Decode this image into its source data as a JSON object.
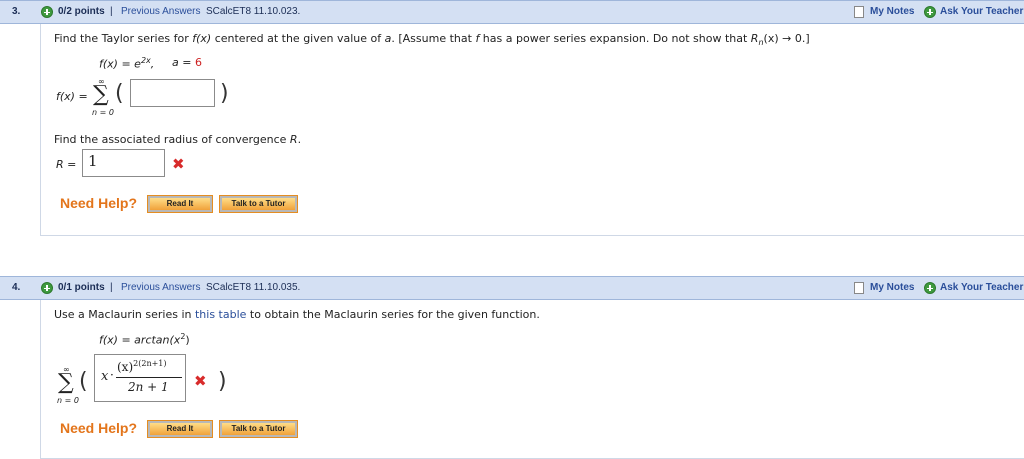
{
  "q3": {
    "number": "3.",
    "points": "0/2 points",
    "separator": "|",
    "previous_answers": "Previous Answers",
    "code": "SCalcET8 11.10.023.",
    "my_notes": "My Notes",
    "ask_teacher": "Ask Your Teacher",
    "prompt_a": "Find the Taylor series for ",
    "prompt_fx": "f(x)",
    "prompt_b": " centered at the given value of ",
    "prompt_avar": "a",
    "prompt_c": ". [Assume that ",
    "prompt_f": "f",
    "prompt_d": " has a power series expansion. Do not show that ",
    "prompt_rn": "R",
    "prompt_rn_sub": "n",
    "prompt_e": "(x) → 0.]",
    "func_lhs": "f(x) = e",
    "func_exp": "2x",
    "func_comma": ",",
    "a_label": "a = ",
    "a_value": "6",
    "series_lhs": "f(x) = ",
    "sum_top": "∞",
    "sum_bottom": "n = 0",
    "sigma": "∑",
    "paren_open": "(",
    "paren_close": ")",
    "series_answer": "",
    "radius_prompt_a": "Find the associated radius of convergence ",
    "radius_prompt_r": "R",
    "radius_prompt_b": ".",
    "radius_label": "R = ",
    "radius_value": "1",
    "radius_status": "✖",
    "need_help": "Need Help?",
    "read_it": "Read It",
    "talk_tutor": "Talk to a Tutor"
  },
  "q4": {
    "number": "4.",
    "points": "0/1 points",
    "separator": "|",
    "previous_answers": "Previous Answers",
    "code": "SCalcET8 11.10.035.",
    "my_notes": "My Notes",
    "ask_teacher": "Ask Your Teacher",
    "prompt_a": "Use a Maclaurin series in ",
    "prompt_link": "this table",
    "prompt_b": " to obtain the Maclaurin series for the given function.",
    "func_lhs": "f(x) = arctan(x",
    "func_exp": "2",
    "func_rhs": ")",
    "sum_top": "∞",
    "sum_bottom": "n = 0",
    "sigma": "∑",
    "paren_open": "(",
    "paren_close": ")",
    "answer_x": "x",
    "answer_dot": "·",
    "answer_num": "(x)",
    "answer_num_exp": "2(2n+1)",
    "answer_den": "2n + 1",
    "answer_status": "✖",
    "need_help": "Need Help?",
    "read_it": "Read It",
    "talk_tutor": "Talk to a Tutor"
  },
  "colors": {
    "header_bg": "#d4e0f3",
    "error_red": "#d82b2b",
    "need_help_orange": "#e3751b",
    "link_blue": "#2a4e9a"
  }
}
